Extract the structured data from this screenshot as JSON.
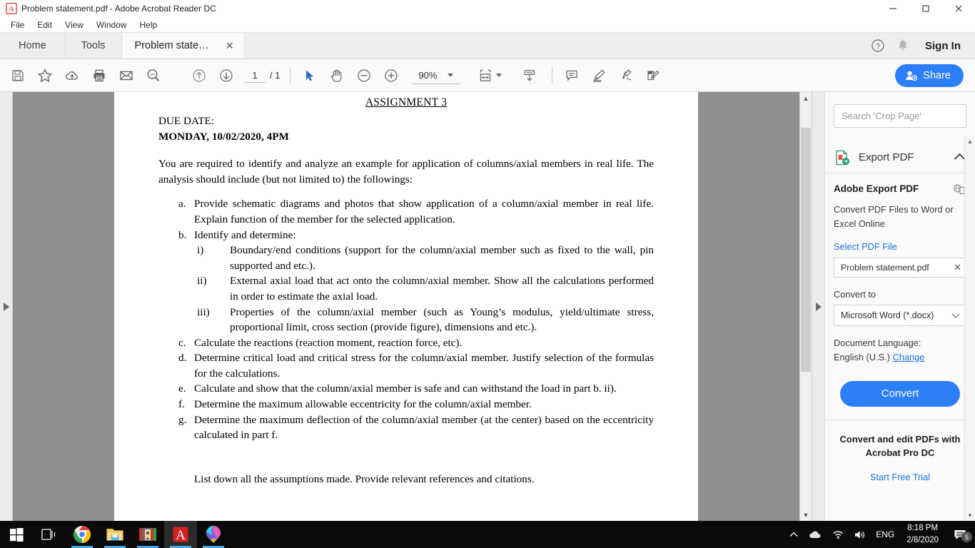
{
  "window": {
    "title": "Problem statement.pdf - Adobe Acrobat Reader DC",
    "minimize": "—",
    "maximize": "❐",
    "close": "✕"
  },
  "menu": {
    "items": [
      {
        "label": "File"
      },
      {
        "label": "Edit"
      },
      {
        "label": "View"
      },
      {
        "label": "Window"
      },
      {
        "label": "Help"
      }
    ]
  },
  "tabs": {
    "home": "Home",
    "tools": "Tools",
    "document": "Problem statement....",
    "close_glyph": "✕",
    "sign_in": "Sign In"
  },
  "toolbar": {
    "page_current": "1",
    "page_total": "/ 1",
    "zoom": "90%",
    "share_label": "Share",
    "icons": [
      "save-icon",
      "star-icon",
      "upload-cloud-icon",
      "print-icon",
      "email-icon",
      "search-icon",
      "previous-page-icon",
      "next-page-icon",
      "select-tool-icon",
      "hand-tool-icon",
      "zoom-out-icon",
      "zoom-in-icon",
      "fit-width-icon",
      "scroll-mode-icon",
      "comment-icon",
      "highlight-icon",
      "sign-icon",
      "fill-and-sign-icon"
    ]
  },
  "right_panel": {
    "search_placeholder": "Search 'Crop Page'",
    "section_title": "Export PDF",
    "card_title": "Adobe Export PDF",
    "card_subtitle": "Convert PDF Files to Word or Excel Online",
    "select_file_label": "Select PDF File",
    "file_name": "Problem statement.pdf",
    "file_remove_glyph": "✕",
    "convert_to_label": "Convert to",
    "convert_to_value": "Microsoft Word (*.docx)",
    "document_language_label": "Document Language:",
    "document_language_value": "English (U.S.)",
    "change_link": "Change",
    "convert_button": "Convert",
    "promo_title": "Convert and edit PDFs with Acrobat Pro DC",
    "promo_link": "Start Free Trial"
  },
  "document": {
    "heading": "ASSIGNMENT 3",
    "due_label": "DUE DATE:",
    "due_value": "MONDAY, 10/02/2020, 4PM",
    "intro": "You are required to identify and analyze an example for application of columns/axial members in real life. The analysis should include (but not limited to) the followings:",
    "items": [
      {
        "marker": "a.",
        "text": "Provide schematic diagrams and photos that show application of a column/axial member in real life. Explain function of the member for the selected application."
      },
      {
        "marker": "b.",
        "text": "Identify and determine:",
        "sub": [
          {
            "marker": "i)",
            "text": "Boundary/end conditions (support for the column/axial member such as fixed to the wall, pin supported and etc.)."
          },
          {
            "marker": "ii)",
            "text": "External axial load that act onto the column/axial member. Show all the calculations performed in order to estimate the axial load."
          },
          {
            "marker": "iii)",
            "text": "Properties of the column/axial member (such as Young’s modulus, yield/ultimate stress, proportional limit, cross section (provide figure), dimensions and etc.)."
          }
        ]
      },
      {
        "marker": "c.",
        "text": "Calculate the reactions (reaction moment, reaction force, etc)."
      },
      {
        "marker": "d.",
        "text": "Determine critical load and critical stress for the column/axial member. Justify selection of the formulas for the calculations."
      },
      {
        "marker": "e.",
        "text": "Calculate and show that the column/axial member is safe and can withstand the load in part b. ii)."
      },
      {
        "marker": "f.",
        "text": "Determine the maximum allowable eccentricity for the column/axial member."
      },
      {
        "marker": "g.",
        "text": "Determine the maximum deflection of the column/axial member (at the center) based on the eccentricity calculated in part f."
      }
    ],
    "closing": "List down all the assumptions made. Provide relevant references and citations."
  },
  "taskbar": {
    "items": [
      {
        "name": "start-button"
      },
      {
        "name": "task-view-button"
      },
      {
        "name": "chrome-app"
      },
      {
        "name": "file-explorer-app"
      },
      {
        "name": "winrar-app"
      },
      {
        "name": "acrobat-reader-app"
      },
      {
        "name": "paint-3d-app"
      }
    ],
    "language": "ENG",
    "time": "8:18 PM",
    "date": "2/8/2020",
    "notification_count": "5"
  },
  "colors": {
    "accent_blue": "#2d7ff9",
    "link_blue": "#1473e6",
    "doc_background": "#909090",
    "panel_background": "#fafafa",
    "taskbar": "#0a0a0a"
  }
}
